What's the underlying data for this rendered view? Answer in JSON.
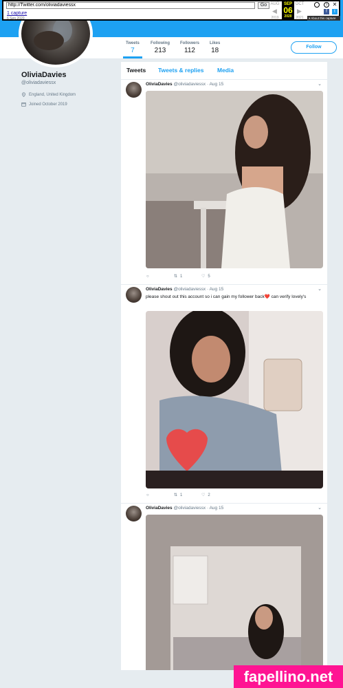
{
  "wayback": {
    "url": "http://Twitter.com/oliviadaviessx",
    "go_label": "Go",
    "captures_link": "1 capture",
    "capture_date": "6 Sep 2020",
    "months": [
      "AUG",
      "SEP",
      "OCT"
    ],
    "day": "06",
    "years": [
      "2019",
      "2020",
      "2021"
    ],
    "about_label": "About this capture"
  },
  "profile": {
    "name": "OliviaDavies",
    "handle": "@oliviadaviessx",
    "location": "England, United Kingdom",
    "joined": "Joined October 2019"
  },
  "stats": [
    {
      "label": "Tweets",
      "value": "7"
    },
    {
      "label": "Following",
      "value": "213"
    },
    {
      "label": "Followers",
      "value": "112"
    },
    {
      "label": "Likes",
      "value": "18"
    }
  ],
  "follow_label": "Follow",
  "tabs": [
    "Tweets",
    "Tweets & replies",
    "Media"
  ],
  "tweets": [
    {
      "name": "OliviaDavies",
      "handle": "@oliviadaviessx · Aug 15",
      "text": "",
      "retweets": "1",
      "likes": "5"
    },
    {
      "name": "OliviaDavies",
      "handle": "@oliviadaviessx · Aug 15",
      "text": "please shout out this account so i can gain my follower back❤️ can verify lovely's",
      "retweets": "1",
      "likes": "2"
    },
    {
      "name": "OliviaDavies",
      "handle": "@oliviadaviessx · Aug 15",
      "text": "",
      "retweets": "",
      "likes": ""
    }
  ],
  "watermark": "fapellino.net",
  "colors": {
    "accent": "#1da1f2",
    "watermark": "#ff1493"
  }
}
